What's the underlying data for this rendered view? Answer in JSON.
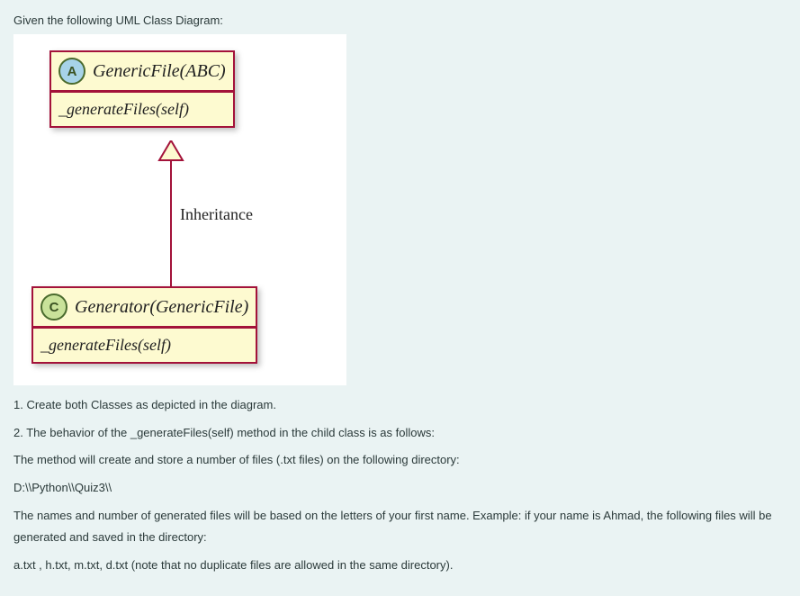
{
  "intro": "Given the following UML Class Diagram:",
  "diagram": {
    "classA": {
      "badge": "A",
      "title": "GenericFile(ABC)",
      "method": "_generateFiles(self)"
    },
    "relation_label": "Inheritance",
    "classC": {
      "badge": "C",
      "title": "Generator(GenericFile)",
      "method": "_generateFiles(self)"
    }
  },
  "instructions": {
    "line1": "1. Create both Classes as depicted in the diagram.",
    "line2": "2. The behavior of the _generateFiles(self) method in the child class is as follows:",
    "line3": "The method will create and store a number of files (.txt files) on the following directory:",
    "line4": "D:\\\\Python\\\\Quiz3\\\\",
    "line5": "The names and number of generated files will be based on the letters of your first name. Example: if your name is Ahmad, the following files will be generated and saved in the directory:",
    "line6": "a.txt , h.txt, m.txt, d.txt (note that no duplicate files are allowed in the same directory)."
  }
}
